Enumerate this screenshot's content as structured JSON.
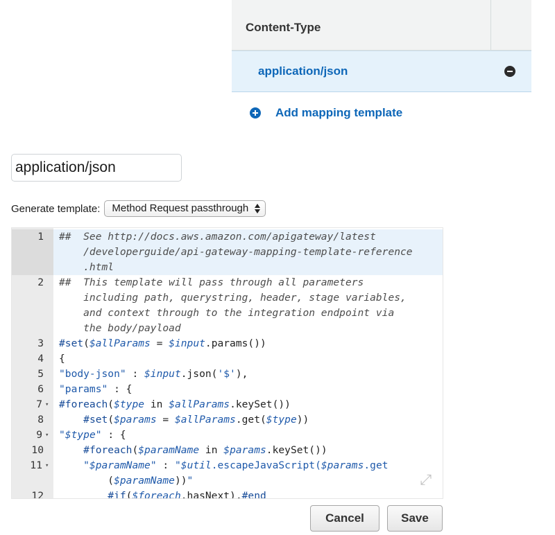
{
  "content_type_table": {
    "header": "Content-Type",
    "rows": [
      {
        "label": "application/json"
      }
    ]
  },
  "add_mapping": {
    "label": "Add mapping template"
  },
  "content_type_input": {
    "value": "application/json"
  },
  "generate_template": {
    "label": "Generate template:",
    "selected": "Method Request passthrough"
  },
  "editor": {
    "lines": [
      {
        "num": "1",
        "fold": "",
        "wrap": [
          "##  See http://docs.aws.amazon.com/apigateway/latest",
          "    /developerguide/api-gateway-mapping-template-reference",
          "    .html"
        ],
        "kind": "comment"
      },
      {
        "num": "2",
        "fold": "",
        "wrap": [
          "##  This template will pass through all parameters",
          "    including path, querystring, header, stage variables,",
          "    and context through to the integration endpoint via",
          "    the body/payload"
        ],
        "kind": "comment"
      },
      {
        "num": "3",
        "fold": "",
        "text": "#set($allParams = $input.params())"
      },
      {
        "num": "4",
        "fold": "",
        "text": "{"
      },
      {
        "num": "5",
        "fold": "",
        "text": "\"body-json\" : $input.json('$'),"
      },
      {
        "num": "6",
        "fold": "",
        "text": "\"params\" : {"
      },
      {
        "num": "7",
        "fold": "▾",
        "text": "#foreach($type in $allParams.keySet())"
      },
      {
        "num": "8",
        "fold": "",
        "text": "    #set($params = $allParams.get($type))"
      },
      {
        "num": "9",
        "fold": "▾",
        "text": "\"$type\" : {"
      },
      {
        "num": "10",
        "fold": "",
        "text": "    #foreach($paramName in $params.keySet())"
      },
      {
        "num": "11",
        "fold": "▾",
        "wrap": [
          "    \"$paramName\" : \"$util.escapeJavaScript($params.get",
          "        ($paramName))\""
        ]
      },
      {
        "num": "12",
        "fold": "",
        "text": "        #if($foreach.hasNext),#end"
      }
    ]
  },
  "buttons": {
    "cancel": "Cancel",
    "save": "Save"
  }
}
